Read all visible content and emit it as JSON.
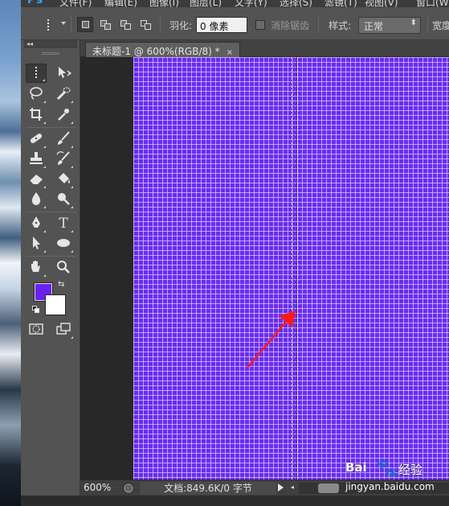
{
  "app": {
    "logo": "Ps"
  },
  "menubar": {
    "items": [
      "文件(F)",
      "编辑(E)",
      "图像(I)",
      "图层(L)",
      "文字(Y)",
      "选择(S)",
      "滤镜(T)",
      "视图(V)",
      "窗口(W)"
    ]
  },
  "options": {
    "tool_preset_icon": "single-column-marquee-icon",
    "feather_label": "羽化:",
    "feather_value": "0 像素",
    "antialias_label": "消除锯齿",
    "style_label": "样式:",
    "style_value": "正常",
    "width_label": "宽度"
  },
  "toolbox": {
    "collapse_label": "◂◂",
    "colors": {
      "foreground": "#6a22f2",
      "background": "#ffffff"
    }
  },
  "document": {
    "tab_title": "未标题-1 @ 600%(RGB/8) *",
    "tab_close": "×",
    "canvas_color": "#6a2cf0"
  },
  "status": {
    "zoom": "600%",
    "doc_info": "文档:849.6K/0 字节"
  },
  "watermark": {
    "brand_a": "Bai",
    "brand_b": "经验",
    "url": "jingyan.baidu.com"
  },
  "annotation": {
    "arrow_color": "#ff1a1a"
  }
}
